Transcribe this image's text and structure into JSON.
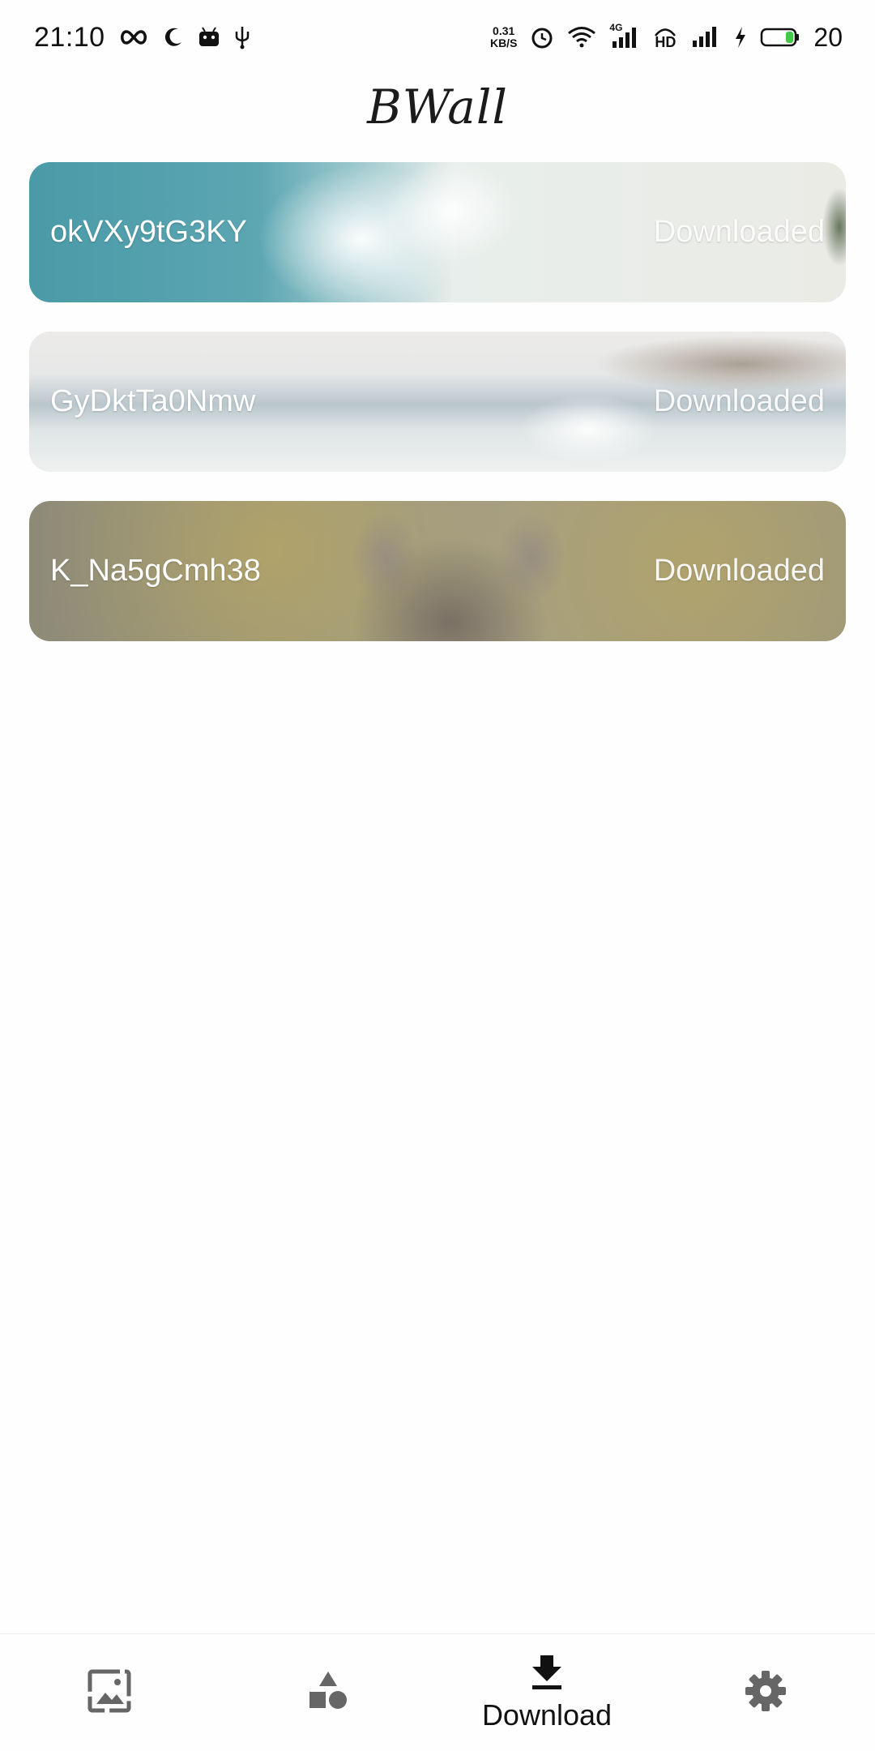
{
  "status_bar": {
    "time": "21:10",
    "net_speed_value": "0.31",
    "net_speed_unit": "KB/S",
    "network_type": "4G",
    "hd_label": "HD",
    "battery_percent": "20",
    "icons_left": [
      "infinity-icon",
      "moon-icon",
      "android-icon",
      "usb-icon"
    ],
    "icons_right": [
      "alarm-icon",
      "wifi-icon",
      "signal-icon",
      "hd-icon",
      "signal-icon",
      "charging-icon",
      "battery-icon"
    ]
  },
  "header": {
    "title": "BWall"
  },
  "downloads": [
    {
      "name": "okVXy9tG3KY",
      "status": "Downloaded"
    },
    {
      "name": "GyDktTa0Nmw",
      "status": "Downloaded"
    },
    {
      "name": "K_Na5gCmh38",
      "status": "Downloaded"
    }
  ],
  "bottom_nav": {
    "items": [
      {
        "icon": "image-icon",
        "label": ""
      },
      {
        "icon": "shapes-icon",
        "label": ""
      },
      {
        "icon": "download-icon",
        "label": "Download",
        "active": true
      },
      {
        "icon": "gear-icon",
        "label": ""
      }
    ]
  },
  "colors": {
    "icon_gray": "#666666",
    "text_primary": "#111111",
    "battery_green": "#43c843"
  }
}
